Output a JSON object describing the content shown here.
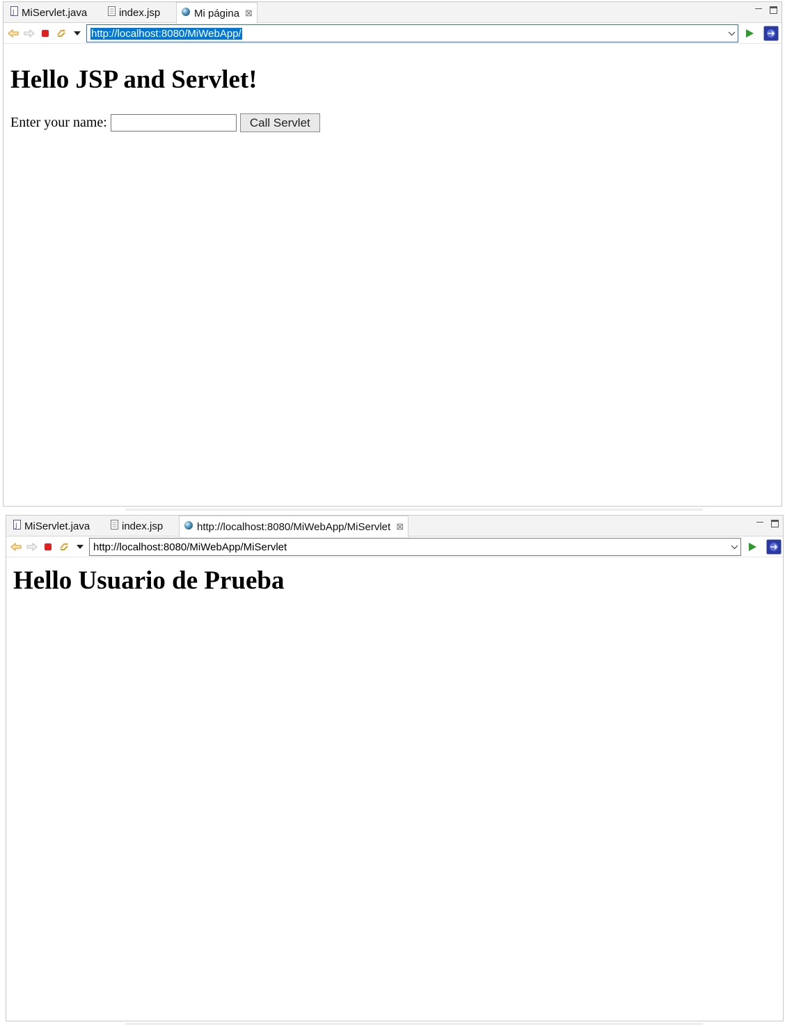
{
  "top_editor": {
    "tabs": [
      {
        "label": "MiServlet.java",
        "icon": "java-file-icon"
      },
      {
        "label": "index.jsp",
        "icon": "jsp-file-icon"
      },
      {
        "label": "Mi página",
        "icon": "globe-icon",
        "active": true,
        "close": "⊠"
      }
    ],
    "url": "http://localhost:8080/MiWebApp/",
    "url_selected": true,
    "page": {
      "heading": "Hello JSP and Servlet!",
      "form_label": "Enter your name:",
      "name_value": "",
      "submit_label": "Call Servlet"
    }
  },
  "bottom_editor": {
    "tabs": [
      {
        "label": "MiServlet.java",
        "icon": "java-file-icon"
      },
      {
        "label": "index.jsp",
        "icon": "jsp-file-icon"
      },
      {
        "label": "http://localhost:8080/MiWebApp/MiServlet",
        "icon": "globe-icon",
        "active": true,
        "close": "⊠"
      }
    ],
    "url": "http://localhost:8080/MiWebApp/MiServlet",
    "page": {
      "heading": "Hello Usuario de Prueba"
    }
  },
  "colors": {
    "back_forward": "#e8a33a",
    "stop": "#e02020",
    "go": "#2e9a2e",
    "selection": "#0078d7"
  }
}
